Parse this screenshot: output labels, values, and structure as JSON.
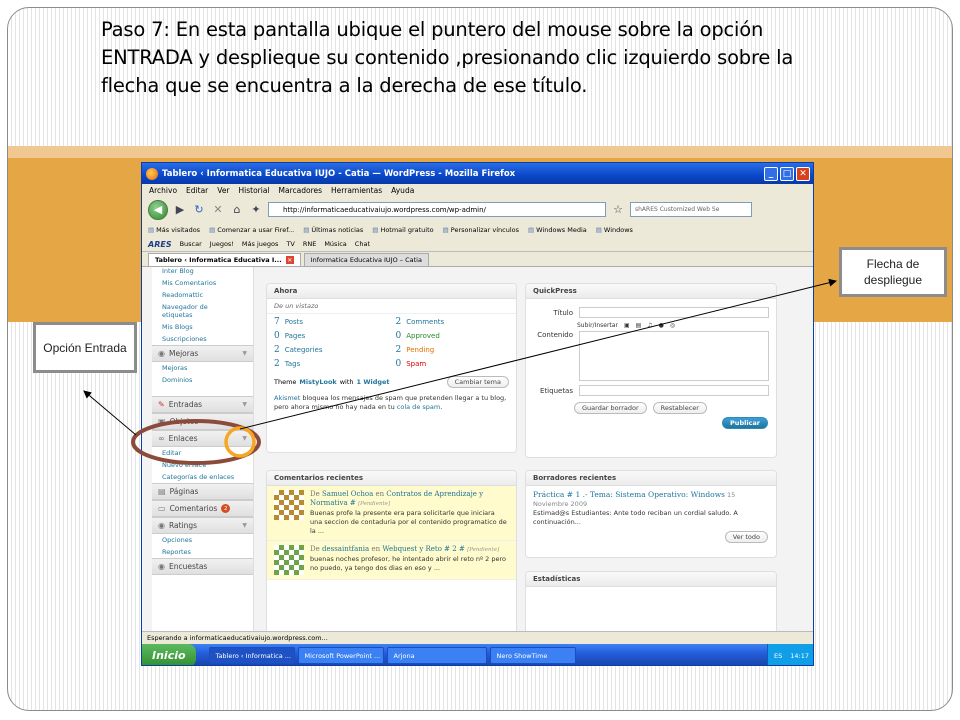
{
  "slide": {
    "title": "Paso 7: En esta pantalla ubique el puntero del mouse sobre la opción ENTRADA  y desplieque su contenido ,presionando clic izquierdo sobre la flecha que se encuentra a la derecha de ese título."
  },
  "callouts": {
    "left": "Opción Entrada",
    "right": "Flecha de despliegue"
  },
  "colors": {
    "accent_band": "#e5a646",
    "circle_brown": "#8b4a3a",
    "circle_orange": "#f5a623"
  },
  "browser": {
    "title": "Tablero ‹ Informatica Educativa IUJO - Catia — WordPress - Mozilla Firefox",
    "menu": [
      "Archivo",
      "Editar",
      "Ver",
      "Historial",
      "Marcadores",
      "Herramientas",
      "Ayuda"
    ],
    "url": "http://informaticaeducativaiujo.wordpress.com/wp-admin/",
    "search_placeholder": "shARES Customized Web Se",
    "bookmarks": [
      "Más visitados",
      "Comenzar a usar Firef...",
      "Últimas noticias",
      "Hotmail gratuito",
      "Personalizar vínculos",
      "Windows Media",
      "Windows"
    ],
    "ares": {
      "logo": "ARES",
      "buscar": "Buscar",
      "juegos": "Juegos!",
      "mas_juegos": "Más juegos",
      "tv": "TV",
      "rne": "RNE",
      "musica": "Música",
      "chat": "Chat"
    },
    "tabs": [
      "Tablero ‹ Informatica Educativa I...",
      "Informatica Educativa IUJO – Catia"
    ],
    "status": "Esperando a informaticaeducativaiujo.wordpress.com..."
  },
  "sidebar": {
    "top_items": [
      "Inter Blog",
      "Mis Comentarios",
      "Readomattic",
      "Navegador de etiquetas",
      "Mis Blogs",
      "Suscripciones"
    ],
    "mejoras": "Mejoras",
    "mejoras_items": [
      "Mejoras",
      "Dominios"
    ],
    "entradas": "Entradas",
    "objetos": "Objetos",
    "enlaces": "Enlaces",
    "enlaces_items": [
      "Editar",
      "Nuevo enlace",
      "Categorías de enlaces"
    ],
    "paginas": "Páginas",
    "comentarios": "Comentarios",
    "comentarios_badge": "2",
    "ratings": "Ratings",
    "ratings_items": [
      "Opciones",
      "Reportes"
    ],
    "encuestas": "Encuestas"
  },
  "ahora": {
    "title": "Ahora",
    "subtitle": "De un vistazo",
    "stats": [
      {
        "n": "7",
        "label": "Posts",
        "cls": "lbl"
      },
      {
        "n": "2",
        "label": "Comments",
        "cls": "lbl"
      },
      {
        "n": "0",
        "label": "Pages",
        "cls": "lbl"
      },
      {
        "n": "0",
        "label": "Approved",
        "cls": "g"
      },
      {
        "n": "2",
        "label": "Categories",
        "cls": "lbl"
      },
      {
        "n": "2",
        "label": "Pending",
        "cls": "o"
      },
      {
        "n": "2",
        "label": "Tags",
        "cls": "lbl"
      },
      {
        "n": "0",
        "label": "Spam",
        "cls": "r"
      }
    ],
    "theme_prefix": "Theme",
    "theme_name": "MistyLook",
    "theme_with": "with",
    "widgets": "1 Widget",
    "cambiar": "Cambiar tema",
    "akismet_link": "Akismet",
    "akismet_text": " bloquea los mensajes de spam que pretenden llegar a tu blog, pero ahora mismo no hay nada en tu ",
    "spam_link": "cola de spam",
    "akismet_end": "."
  },
  "quickpress": {
    "title": "QuickPress",
    "titulo": "Título",
    "subir": "Subir/Insertar",
    "contenido": "Contenido",
    "etiquetas": "Etiquetas",
    "guardar": "Guardar borrador",
    "restablecer": "Restablecer",
    "publicar": "Publicar"
  },
  "comentarios": {
    "title": "Comentarios recientes",
    "items": [
      {
        "de": "De ",
        "author": "Samuel Ochoa",
        "en": " en ",
        "post": "Contratos de Aprendizaje y Normativa",
        "num": " # ",
        "pend": "[Pendiente]",
        "text": "Buenas profe la presente era para solicitarle que iniciara una seccion de contaduria por el contenido programatico de la ..."
      },
      {
        "de": "De ",
        "author": "dessaintfania",
        "en": " en ",
        "post": "Webquest y Reto # 2",
        "num": " # ",
        "pend": "[Pendiente]",
        "text": "buenas noches profesor, he intentado abrir el reto nº 2 pero no puedo, ya tengo dos dias en eso y ..."
      }
    ]
  },
  "borradores": {
    "title": "Borradores recientes",
    "post": "Práctica # 1 .- Tema: Sistema Operativo: Windows",
    "date": "15 Noviembre 2009",
    "text": "Estimad@s Estudiantes: Ante todo reciban un cordial saludo. A continuación...",
    "ver": "Ver todo"
  },
  "estadisticas": {
    "title": "Estadísticas"
  },
  "taskbar": {
    "start": "Inicio",
    "tasks": [
      "Tablero ‹ Informatica ...",
      "Microsoft PowerPoint ...",
      "Arjona",
      "Nero ShowTime"
    ],
    "lang": "ES",
    "time": "14:17"
  }
}
